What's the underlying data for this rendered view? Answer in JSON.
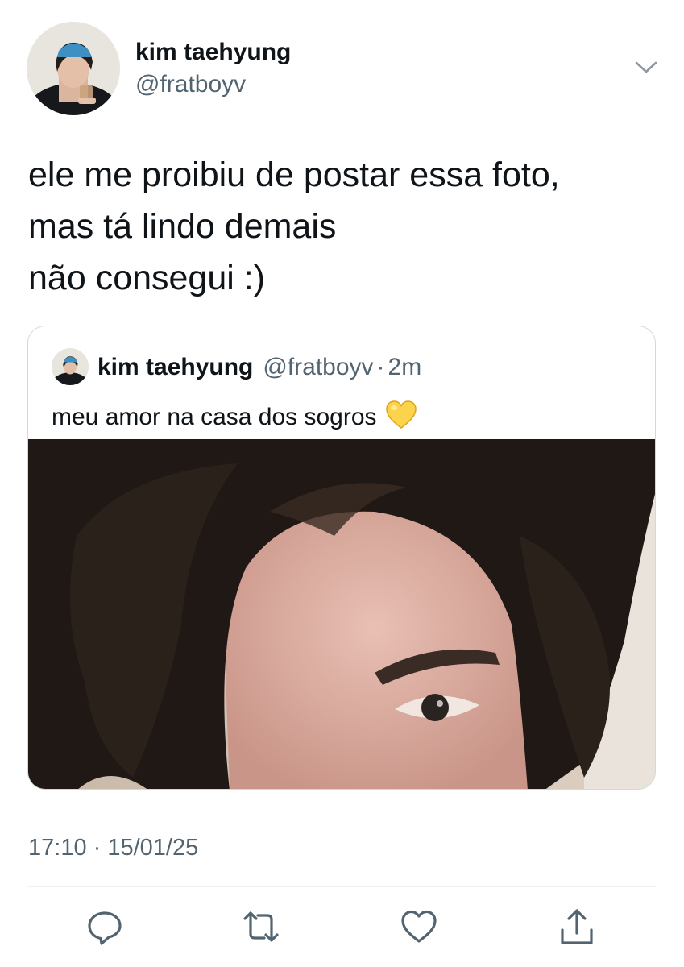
{
  "tweet": {
    "author": {
      "name": "kim taehyung",
      "handle": "@fratboyv",
      "avatar_icon": "profile-photo"
    },
    "text_lines": [
      "ele me proibiu de postar essa foto,",
      "mas tá lindo demais",
      "não consegui :)"
    ],
    "quoted": {
      "name": "kim taehyung",
      "handle": "@fratboyv",
      "separator": "·",
      "time": "2m",
      "text": "meu amor na casa dos sogros",
      "emoji": "yellow-heart"
    },
    "timestamp": "17:10 · 15/01/25",
    "actions": [
      "reply-icon",
      "retweet-icon",
      "like-icon",
      "share-icon"
    ]
  },
  "colors": {
    "text_primary": "#0f1419",
    "text_secondary": "#536471",
    "border": "#cfd9de",
    "divider": "#eff3f4"
  }
}
